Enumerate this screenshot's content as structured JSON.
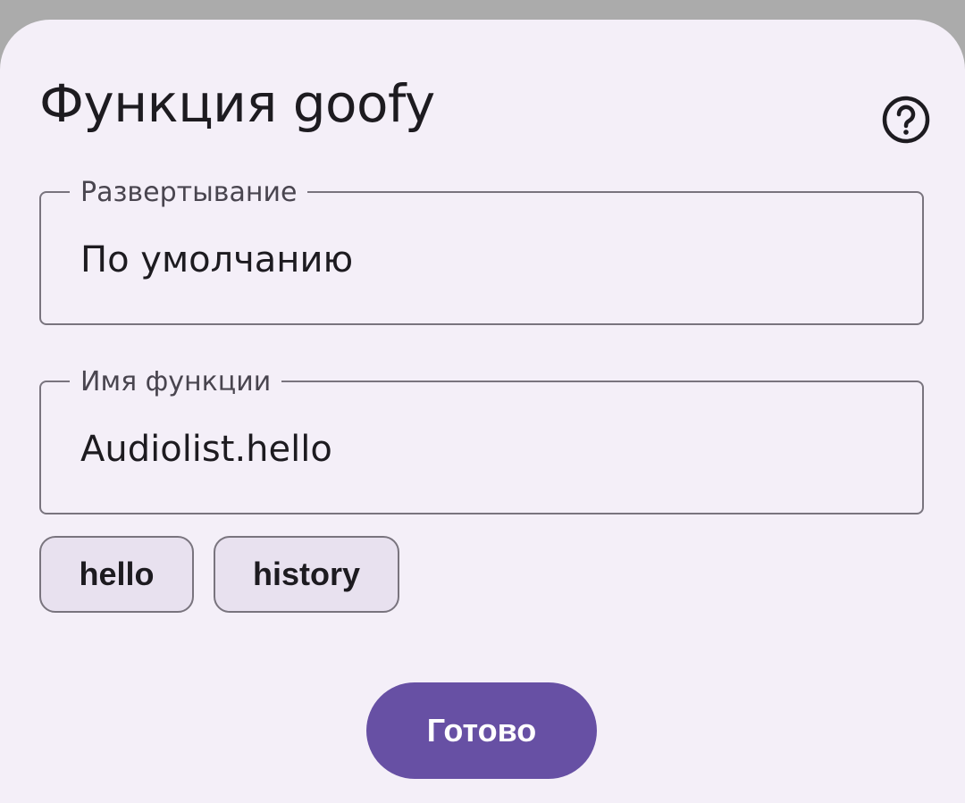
{
  "dialog": {
    "title": "Функция goofy",
    "help_icon": "help-circle-icon"
  },
  "deployment": {
    "label": "Развертывание",
    "value": "По умолчанию"
  },
  "function_name": {
    "label": "Имя функции",
    "value": "Audiolist.hello"
  },
  "suggestions": [
    {
      "label": "hello"
    },
    {
      "label": "history"
    }
  ],
  "actions": {
    "done_label": "Готово"
  },
  "colors": {
    "accent": "#6750a4",
    "surface": "#f4eff8",
    "chip_bg": "#e8e1ef",
    "outline": "#79747e",
    "scrim": "#ababab"
  }
}
